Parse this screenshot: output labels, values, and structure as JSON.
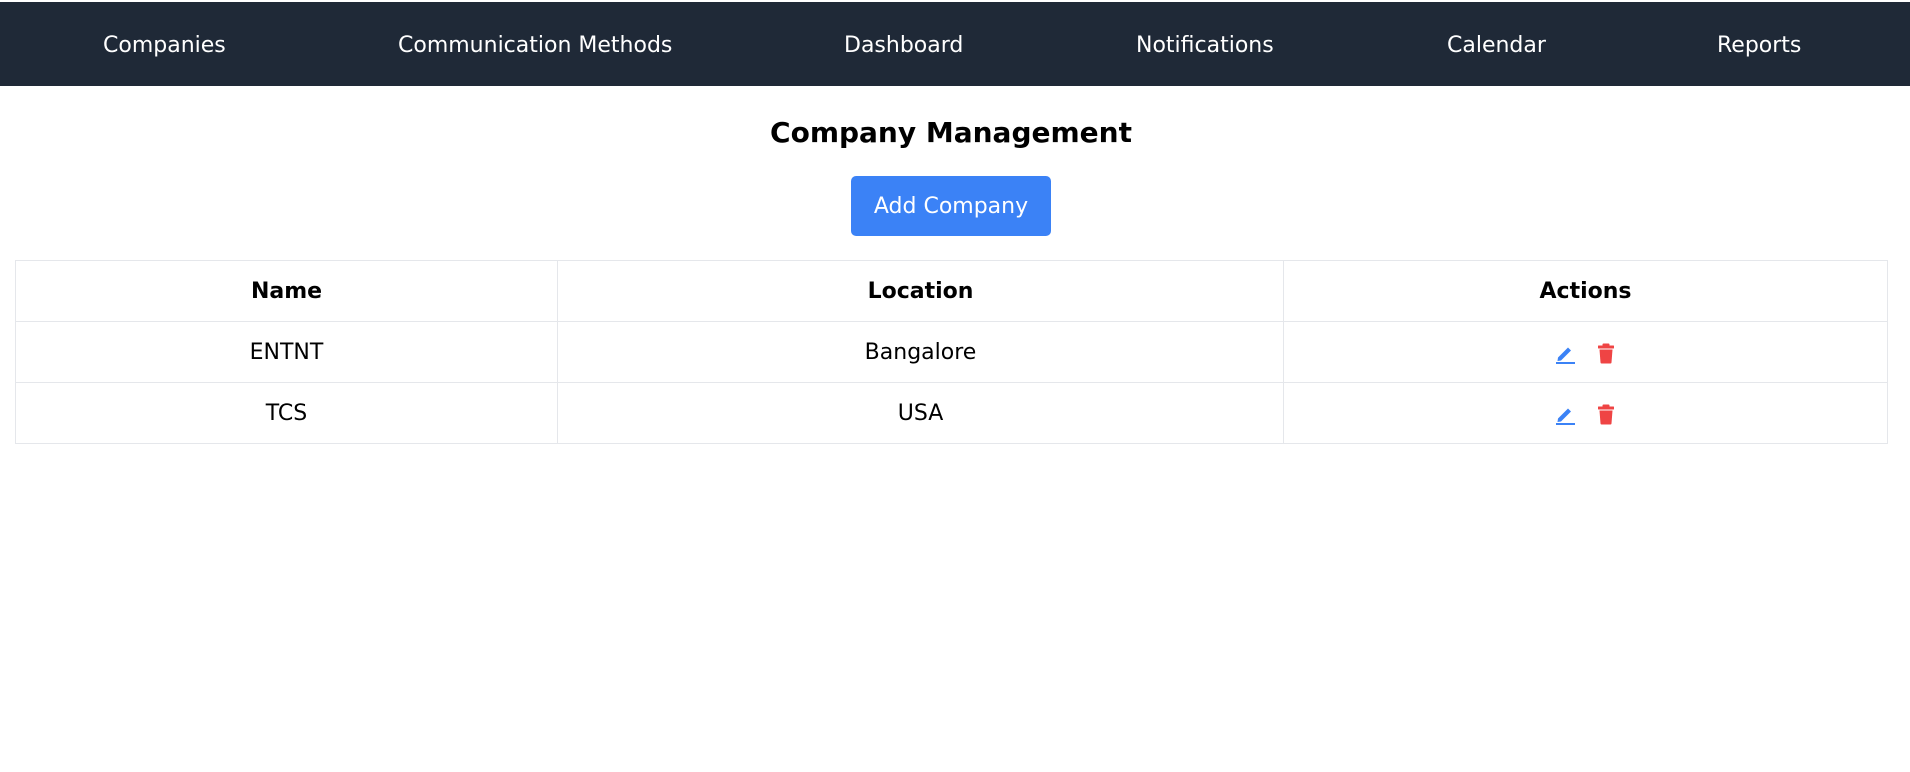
{
  "nav": {
    "items": [
      {
        "label": "Companies"
      },
      {
        "label": "Communication Methods"
      },
      {
        "label": "Dashboard"
      },
      {
        "label": "Notifications"
      },
      {
        "label": "Calendar"
      },
      {
        "label": "Reports"
      }
    ]
  },
  "page": {
    "title": "Company Management",
    "add_button_label": "Add Company"
  },
  "table": {
    "headers": [
      "Name",
      "Location",
      "Actions"
    ],
    "rows": [
      {
        "name": "ENTNT",
        "location": "Bangalore"
      },
      {
        "name": "TCS",
        "location": "USA"
      }
    ]
  },
  "icons": {
    "edit": "pencil-icon",
    "delete": "trash-icon"
  },
  "colors": {
    "navbar": "#1f2937",
    "primary": "#3b82f6",
    "danger": "#ef4444",
    "border": "#e5e7eb"
  }
}
